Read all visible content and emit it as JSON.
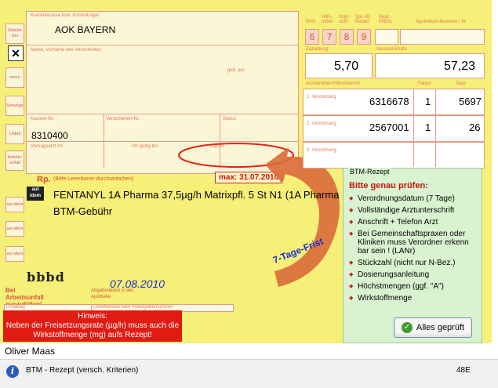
{
  "form": {
    "labels": {
      "gebuehr_frei": "Gebühr frei",
      "noctu": "noctu",
      "sonstige": "Sonstige",
      "unfall": "Unfall",
      "arbeitsunfall": "Arbeits-unfall",
      "krankenkasse": "Krankenkasse bzw. Kostenträger",
      "name": "Name, Vorname des Versicherten",
      "geb_am": "geb. am",
      "kassen_nr": "Kassen-Nr.",
      "versicherten_nr": "Versicherten-Nr.",
      "status": "Status",
      "vertragsarzt_nr": "Vertragsarzt-Nr.",
      "vk_gueltig": "VK gültig bis",
      "datum": "Datum",
      "rp": "Rp.",
      "rp_hint": "(Bitte Leerräume durchstreichen)",
      "aut_idem": "aut idem",
      "bvg": "BVG",
      "hilfsmittel": "Hilfs-mittel",
      "impfstoff": "Impf-stoff",
      "spr_st_bedarf": "Spr.-St. Bedarf",
      "begr_pflicht": "Begr.-Pflicht",
      "apotheken_nr": "Apotheken-Nummer / IK",
      "zuzahlung": "Zuzahlung",
      "gesamt_brutto": "Gesamt-Brutto",
      "pzn_header": "Arzneimittel-/Hilfsmittel-Nr.",
      "faktor": "Faktor",
      "taxe": "Taxe",
      "verordnung_1": "1. Verordnung",
      "verordnung_2": "2. Verordnung",
      "verordnung_3": "3. Verordnung",
      "bei_arbeitsunfall": "Bei Arbeitsunfall auszufüllen!",
      "abgabedatum": "Abgabedatum in der Apotheke",
      "unfalltag": "Unfalltag",
      "unfallbetrieb": "Unfallbetrieb oder Arbeitgebernummer"
    },
    "digits": [
      "6",
      "7",
      "8",
      "9"
    ],
    "krankenkasse_value": "AOK BAYERN",
    "kassen_nr_value": "8310400",
    "max_date": "max:  31.07.2010",
    "drug_line": "FENTANYL 1A Pharma 37,5µg/h Matrixpfl. 5 St N1 (1A Pharma",
    "fee_line": "BTM-Gebühr",
    "zuzahlung_value": "5,70",
    "gesamt_brutto_value": "57,23",
    "rows": [
      {
        "pzn": "6316678",
        "faktor": "1",
        "taxe": "5697"
      },
      {
        "pzn": "2567001",
        "faktor": "1",
        "taxe": "26"
      }
    ],
    "arrow_text": "7-Tage-Frist",
    "signature": "bbbd",
    "abgabedatum_value": "07.08.2010",
    "hint_title": "Hinweis:",
    "hint_text": "Neben der Freisetzungsrate (µg/h) muss auch die Wirkstoffmenge (mg)  aufs Rezept!"
  },
  "panel": {
    "title": "BTM-Rezept",
    "heading": "Bitte genau prüfen:",
    "items": [
      "Verordnungsdatum (7 Tage)",
      "Vollständige Arztunterschrift",
      "Anschrift + Telefon Arzt",
      "Bei Gemeinschaftspraxen oder Kliniken muss Verordner erkenn bar sein ! (LANr)",
      "Stückzahl (nicht nur N-Bez.)",
      "Dosierungsanleitung",
      "Höchstmengen (ggf. \"A\")",
      "Wirkstoffmenge"
    ],
    "button_label": "Alles geprüft"
  },
  "author": "Oliver Maas",
  "status": {
    "title": "BTM - Rezept (versch. Kriterien)",
    "code": "48E"
  },
  "colors": {
    "form_bg": "#f6ef78",
    "form_red": "#d2583c",
    "panel_bg": "#d9f3d0",
    "alert_red": "#e01b12",
    "date_blue": "#1a2fd0",
    "arrow_orange": "#d96a3a"
  }
}
